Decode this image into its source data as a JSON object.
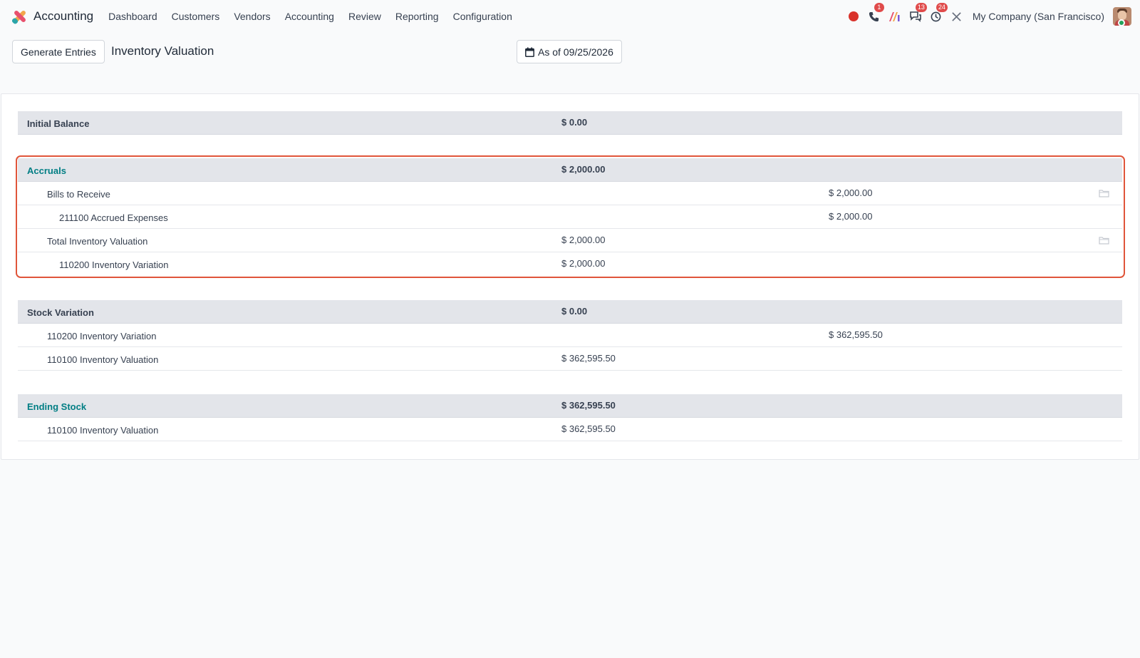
{
  "navbar": {
    "app_name": "Accounting",
    "menu": [
      "Dashboard",
      "Customers",
      "Vendors",
      "Accounting",
      "Review",
      "Reporting",
      "Configuration"
    ],
    "badges": {
      "phone": "1",
      "chat": "13",
      "activity": "24"
    },
    "company": "My Company (San Francisco)",
    "icons": [
      "record-dot-icon",
      "phone-icon",
      "ai-icon",
      "chat-icon",
      "clock-icon",
      "tools-icon"
    ]
  },
  "control": {
    "generate_label": "Generate Entries",
    "title": "Inventory Valuation",
    "date_label": "As of 09/25/2026"
  },
  "report": {
    "sections": [
      {
        "title": "Initial Balance",
        "col1": "$ 0.00",
        "col2": "",
        "teal": false,
        "lines": []
      },
      {
        "title": "Accruals",
        "col1": "$ 2,000.00",
        "col2": "",
        "teal": true,
        "lines": [
          {
            "label": "Bills to Receive",
            "col1": "",
            "col2": "$ 2,000.00",
            "level": 1,
            "folder": true
          },
          {
            "label": "211100 Accrued Expenses",
            "col1": "",
            "col2": "$ 2,000.00",
            "level": 2,
            "folder": false
          },
          {
            "label": "Total Inventory Valuation",
            "col1": "$ 2,000.00",
            "col2": "",
            "level": 1,
            "folder": true
          },
          {
            "label": "110200 Inventory Variation",
            "col1": "$ 2,000.00",
            "col2": "",
            "level": 2,
            "folder": false
          }
        ]
      },
      {
        "title": "Stock Variation",
        "col1": "$ 0.00",
        "col2": "",
        "teal": false,
        "lines": [
          {
            "label": "110200 Inventory Variation",
            "col1": "",
            "col2": "$ 362,595.50",
            "level": 1,
            "folder": false
          },
          {
            "label": "110100 Inventory Valuation",
            "col1": "$ 362,595.50",
            "col2": "",
            "level": 1,
            "folder": false
          }
        ]
      },
      {
        "title": "Ending Stock",
        "col1": "$ 362,595.50",
        "col2": "",
        "teal": true,
        "lines": [
          {
            "label": "110100 Inventory Valuation",
            "col1": "$ 362,595.50",
            "col2": "",
            "level": 1,
            "folder": false
          }
        ]
      }
    ]
  },
  "colors": {
    "accent": "#017e84",
    "highlight": "#e0553a",
    "badge": "#e04b4b"
  }
}
